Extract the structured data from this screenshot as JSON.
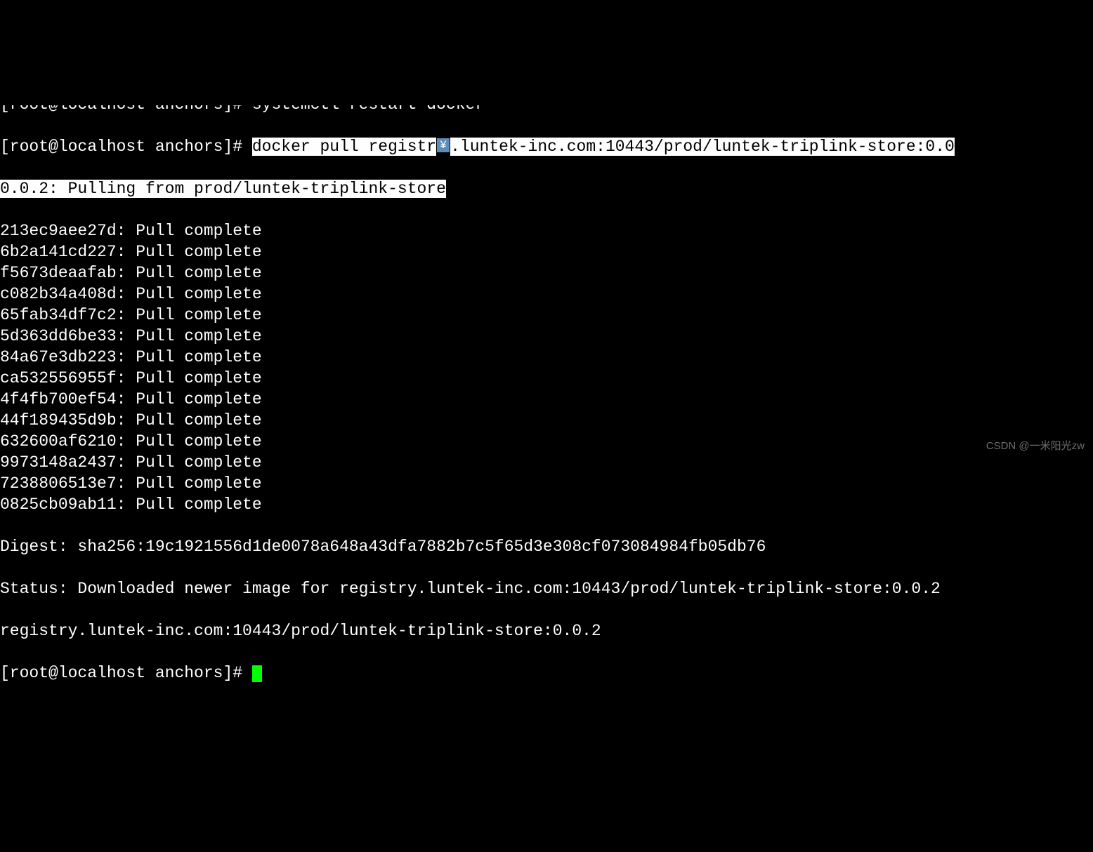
{
  "partial_line": "[root@localhost anchors]# systemctl restart docker",
  "prompt1_prefix": "[root@localhost anchors]# ",
  "cmd_seg1": "docker pull registr",
  "yuan_glyph": "¥",
  "cmd_seg2": ".luntek-inc.com:10443/prod/luntek-triplink-store:0.0",
  "pull_header": "0.0.2: Pulling from prod/luntek-triplink-store",
  "layers": [
    {
      "id": "213ec9aee27d",
      "status": "Pull complete"
    },
    {
      "id": "6b2a141cd227",
      "status": "Pull complete"
    },
    {
      "id": "f5673deaafab",
      "status": "Pull complete"
    },
    {
      "id": "c082b34a408d",
      "status": "Pull complete"
    },
    {
      "id": "65fab34df7c2",
      "status": "Pull complete"
    },
    {
      "id": "5d363dd6be33",
      "status": "Pull complete"
    },
    {
      "id": "84a67e3db223",
      "status": "Pull complete"
    },
    {
      "id": "ca532556955f",
      "status": "Pull complete"
    },
    {
      "id": "4f4fb700ef54",
      "status": "Pull complete"
    },
    {
      "id": "44f189435d9b",
      "status": "Pull complete"
    },
    {
      "id": "632600af6210",
      "status": "Pull complete"
    },
    {
      "id": "9973148a2437",
      "status": "Pull complete"
    },
    {
      "id": "7238806513e7",
      "status": "Pull complete"
    },
    {
      "id": "0825cb09ab11",
      "status": "Pull complete"
    }
  ],
  "digest_line": "Digest: sha256:19c1921556d1de0078a648a43dfa7882b7c5f65d3e308cf073084984fb05db76",
  "status_line": "Status: Downloaded newer image for registry.luntek-inc.com:10443/prod/luntek-triplink-store:0.0.2",
  "ref_line": "registry.luntek-inc.com:10443/prod/luntek-triplink-store:0.0.2",
  "prompt2": "[root@localhost anchors]# ",
  "watermark": "CSDN @一米阳光zw"
}
